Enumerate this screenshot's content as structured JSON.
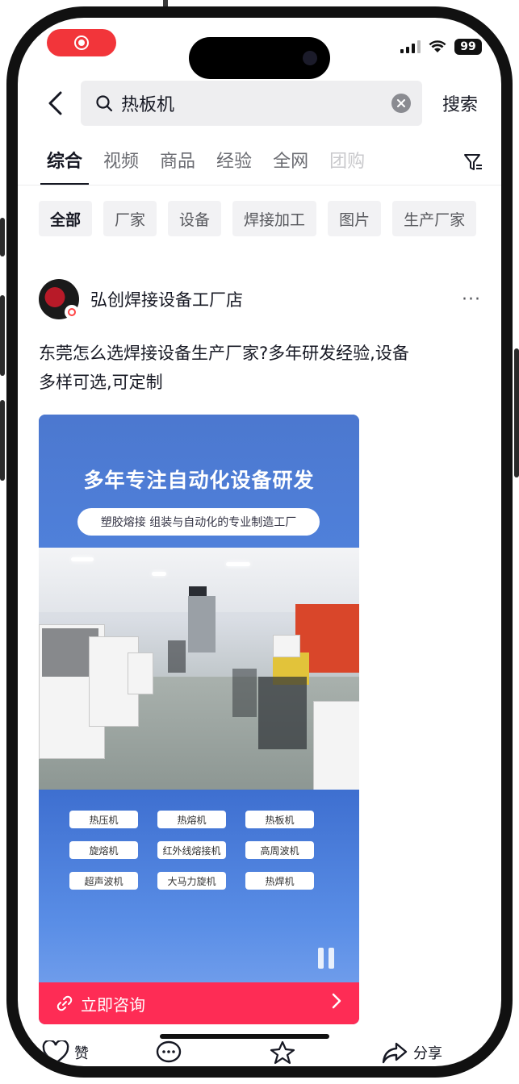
{
  "status_bar": {
    "battery": "99"
  },
  "search": {
    "query": "热板机",
    "submit_label": "搜索"
  },
  "tabs": [
    "综合",
    "视频",
    "商品",
    "经验",
    "全网",
    "团购"
  ],
  "chips": [
    "全部",
    "厂家",
    "设备",
    "焊接加工",
    "图片",
    "生产厂家"
  ],
  "post": {
    "author": "弘创焊接设备工厂店",
    "more": "···",
    "title_line1": "东莞怎么选焊接设备生产厂家?多年研发经验,设备",
    "title_line2": "多样可选,可定制",
    "media": {
      "headline": "多年专注自动化设备研发",
      "subheadline": "塑胶熔接 组装与自动化的专业制造工厂",
      "tags": [
        "热压机",
        "热熔机",
        "热板机",
        "旋熔机",
        "红外线熔接机",
        "高周波机",
        "超声波机",
        "大马力旋机",
        "热焊机"
      ],
      "cta": "立即咨询"
    }
  },
  "actions": {
    "like": "赞",
    "share": "分享"
  },
  "colors": {
    "accent": "#fe2c55",
    "recording": "#f2353a",
    "media_blue": "#4c78cf"
  }
}
